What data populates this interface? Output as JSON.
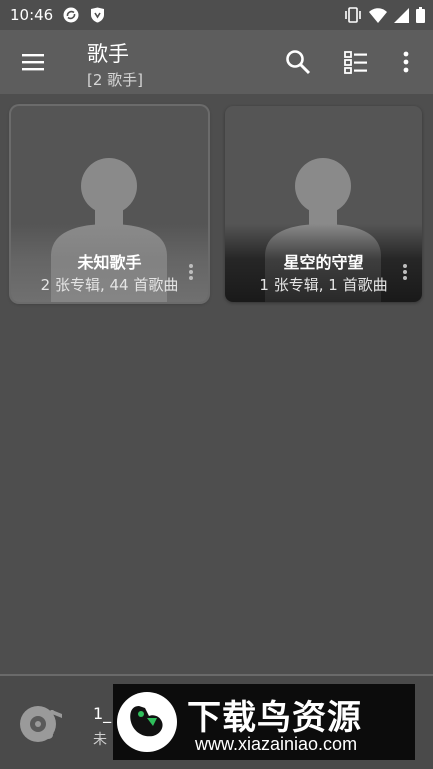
{
  "status_bar": {
    "time": "10:46",
    "icons": [
      "sync-icon",
      "shield-icon",
      "vibrate-icon",
      "wifi-icon",
      "signal-icon",
      "battery-icon"
    ]
  },
  "app_bar": {
    "title": "歌手",
    "subtitle": "[2 歌手]",
    "icons": [
      "menu-icon",
      "search-icon",
      "list-view-icon",
      "more-vert-icon"
    ]
  },
  "artists": [
    {
      "name": "未知歌手",
      "meta": "2 张专辑, 44 首歌曲",
      "selected": true
    },
    {
      "name": "星空的守望",
      "meta": "1 张专辑, 1 首歌曲",
      "selected": false
    }
  ],
  "player": {
    "track": "1_",
    "artist": "未"
  },
  "watermark": {
    "text": "下载鸟资源",
    "url": "www.xiazainiao.com"
  },
  "colors": {
    "background": "#4e4e4e",
    "app_bar": "#5d5d5d",
    "card": "#555555",
    "silhouette": "#8a8a8a"
  }
}
